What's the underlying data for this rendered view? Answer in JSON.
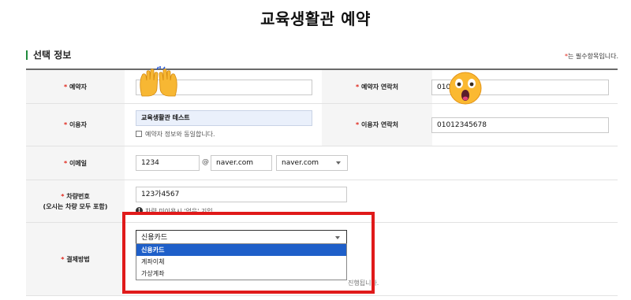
{
  "page": {
    "title": "교육생활관 예약"
  },
  "section": {
    "title": "선택 정보"
  },
  "required_note": {
    "star": "*",
    "text": "는 필수항목입니다."
  },
  "fields": {
    "reserver": {
      "label": "* 예약자",
      "value": ""
    },
    "reserver_phone": {
      "label": "* 예약자 연락처",
      "value": "010"
    },
    "user": {
      "label": "* 이용자",
      "value": "교육생활관 테스트",
      "same_checkbox": "예약자 정보와 동일합니다."
    },
    "user_phone": {
      "label": "* 이용자 연락처",
      "value": "01012345678"
    },
    "email": {
      "label": "* 이메일",
      "local": "1234",
      "at": "@",
      "domain": "naver.com",
      "domain_select": "naver.com"
    },
    "car": {
      "label_line1": "* 차량번호",
      "label_line2": "(오시는 차량 모두 포함)",
      "value": "123가4567",
      "notice": "차량 미이용시 '없음' 기입"
    },
    "payment": {
      "label": "* 결제방법",
      "selected": "신용카드",
      "options": [
        "신용카드",
        "계좌이체",
        "가상계좌"
      ],
      "footnote": "진행됩니다."
    }
  },
  "colors": {
    "accent_green": "#1f8a3c",
    "required_red": "#e0261b",
    "selected_blue": "#1e5fc9",
    "highlight_red": "#e01a1a"
  },
  "icons": {
    "emoji_hands": "raising-hands-emoji",
    "emoji_face": "astonished-face-emoji"
  }
}
